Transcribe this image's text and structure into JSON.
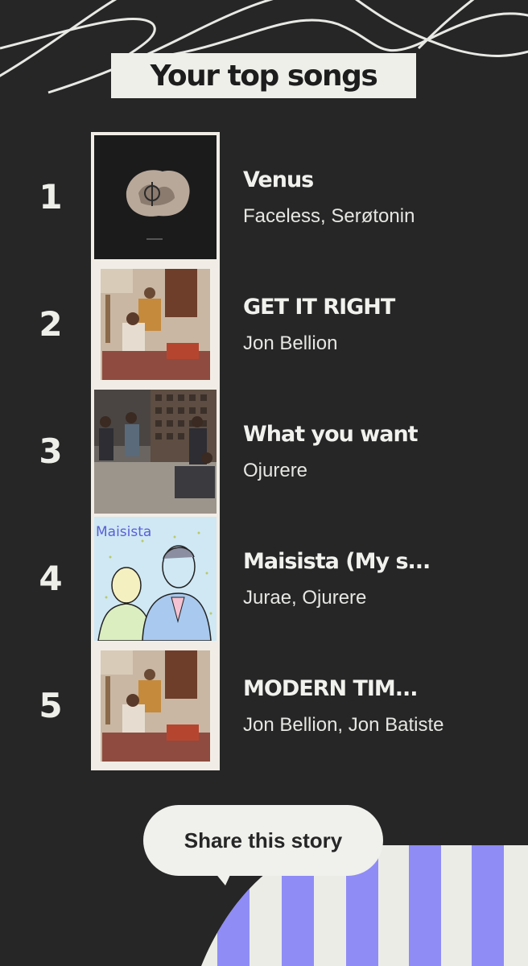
{
  "header": {
    "title": "Your top songs"
  },
  "songs": [
    {
      "rank": "1",
      "title": "Venus",
      "artist": "Faceless, Serøtonin",
      "cover": "venus-cover-art"
    },
    {
      "rank": "2",
      "title": "GET IT RIGHT",
      "artist": "Jon Bellion",
      "cover": "living-room-photo"
    },
    {
      "rank": "3",
      "title": "What you want",
      "artist": "Ojurere",
      "cover": "group-studio-photo"
    },
    {
      "rank": "4",
      "title": "Maisista (My s...",
      "artist": "Jurae, Ojurere",
      "cover": "maisista-drawing",
      "cover_text": "Maisista"
    },
    {
      "rank": "5",
      "title": "MODERN TIM...",
      "artist": "Jon Bellion, Jon Batiste",
      "cover": "living-room-photo"
    }
  ],
  "footer": {
    "share_label": "Share this story"
  },
  "colors": {
    "background": "#262626",
    "title_box": "#efefea",
    "stripe_purple": "#8f8cf6",
    "stripe_light": "#ebece6"
  }
}
